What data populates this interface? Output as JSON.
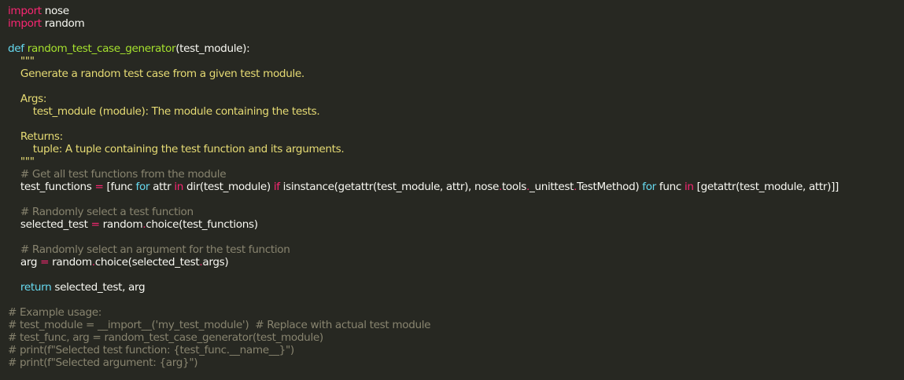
{
  "editor": {
    "theme_colors": {
      "background": "#272822",
      "keyword": "#f92672",
      "keyword_blue": "#66d9ef",
      "function_name": "#a6e22e",
      "string": "#e6db74",
      "comment": "#88846f",
      "text": "#f8f8f2"
    },
    "lines": [
      [
        {
          "t": "import",
          "c": "kw"
        },
        {
          "t": " nose",
          "c": "plain"
        }
      ],
      [
        {
          "t": "import",
          "c": "kw"
        },
        {
          "t": " random",
          "c": "plain"
        }
      ],
      [],
      [
        {
          "t": "def",
          "c": "kw2"
        },
        {
          "t": " ",
          "c": "plain"
        },
        {
          "t": "random_test_case_generator",
          "c": "fn"
        },
        {
          "t": "(test_module):",
          "c": "plain"
        }
      ],
      [
        {
          "t": "    \"\"\"",
          "c": "str"
        }
      ],
      [
        {
          "t": "    Generate a random test case from a given test module.",
          "c": "str"
        }
      ],
      [],
      [
        {
          "t": "    Args:",
          "c": "str"
        }
      ],
      [
        {
          "t": "        test_module (module): The module containing the tests.",
          "c": "str"
        }
      ],
      [],
      [
        {
          "t": "    Returns:",
          "c": "str"
        }
      ],
      [
        {
          "t": "        tuple: A tuple containing the test function and its arguments.",
          "c": "str"
        }
      ],
      [
        {
          "t": "    \"\"\"",
          "c": "str"
        }
      ],
      [
        {
          "t": "    # Get all test functions from the module",
          "c": "cmt"
        }
      ],
      [
        {
          "t": "    test_functions ",
          "c": "plain"
        },
        {
          "t": "=",
          "c": "op"
        },
        {
          "t": " [func ",
          "c": "plain"
        },
        {
          "t": "for",
          "c": "kw2"
        },
        {
          "t": " attr ",
          "c": "plain"
        },
        {
          "t": "in",
          "c": "kw"
        },
        {
          "t": " dir(test_module) ",
          "c": "plain"
        },
        {
          "t": "if",
          "c": "kw"
        },
        {
          "t": " isinstance(getattr(test_module, attr), nose",
          "c": "plain"
        },
        {
          "t": ".",
          "c": "op"
        },
        {
          "t": "tools",
          "c": "plain"
        },
        {
          "t": ".",
          "c": "op"
        },
        {
          "t": "_unittest",
          "c": "plain"
        },
        {
          "t": ".",
          "c": "op"
        },
        {
          "t": "TestMethod) ",
          "c": "plain"
        },
        {
          "t": "for",
          "c": "kw2"
        },
        {
          "t": " func ",
          "c": "plain"
        },
        {
          "t": "in",
          "c": "kw"
        },
        {
          "t": " [getattr(test_module, attr)]]",
          "c": "plain"
        }
      ],
      [],
      [
        {
          "t": "    # Randomly select a test function",
          "c": "cmt"
        }
      ],
      [
        {
          "t": "    selected_test ",
          "c": "plain"
        },
        {
          "t": "=",
          "c": "op"
        },
        {
          "t": " random",
          "c": "plain"
        },
        {
          "t": ".",
          "c": "op"
        },
        {
          "t": "choice(test_functions)",
          "c": "plain"
        }
      ],
      [],
      [
        {
          "t": "    # Randomly select an argument for the test function",
          "c": "cmt"
        }
      ],
      [
        {
          "t": "    arg ",
          "c": "plain"
        },
        {
          "t": "=",
          "c": "op"
        },
        {
          "t": " random",
          "c": "plain"
        },
        {
          "t": ".",
          "c": "op"
        },
        {
          "t": "choice(selected_test",
          "c": "plain"
        },
        {
          "t": ".",
          "c": "op"
        },
        {
          "t": "args)",
          "c": "plain"
        }
      ],
      [],
      [
        {
          "t": "    ",
          "c": "plain"
        },
        {
          "t": "return",
          "c": "kw2"
        },
        {
          "t": " selected_test, arg",
          "c": "plain"
        }
      ],
      [],
      [
        {
          "t": "# Example usage:",
          "c": "cmt"
        }
      ],
      [
        {
          "t": "# test_module = __import__('my_test_module')  # Replace with actual test module",
          "c": "cmt"
        }
      ],
      [
        {
          "t": "# test_func, arg = random_test_case_generator(test_module)",
          "c": "cmt"
        }
      ],
      [
        {
          "t": "# print(f\"Selected test function: {test_func.__name__}\")",
          "c": "cmt"
        }
      ],
      [
        {
          "t": "# print(f\"Selected argument: {arg}\")",
          "c": "cmt"
        }
      ]
    ]
  }
}
